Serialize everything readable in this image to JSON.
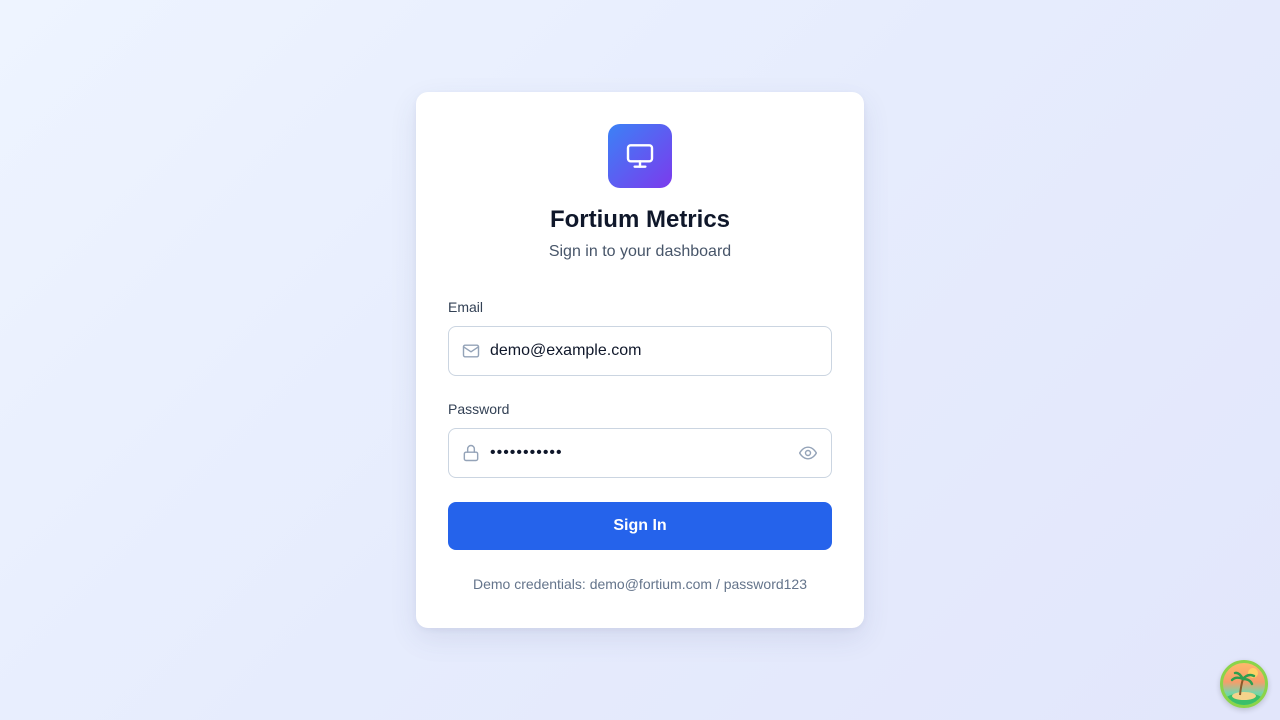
{
  "app": {
    "title": "Fortium Metrics",
    "subtitle": "Sign in to your dashboard"
  },
  "form": {
    "email": {
      "label": "Email",
      "value": "demo@example.com",
      "icon": "mail-icon"
    },
    "password": {
      "label": "Password",
      "masked_value": "•••••••••••",
      "icon": "lock-icon",
      "toggle_icon": "eye-icon"
    },
    "submit_label": "Sign In"
  },
  "footer": {
    "demo_note": "Demo credentials: demo@fortium.com / password123"
  },
  "colors": {
    "primary": "#2563eb",
    "logo_gradient_start": "#3b82f6",
    "logo_gradient_end": "#7c3aed",
    "title": "#0f172a",
    "muted": "#64748b"
  },
  "icons": {
    "logo": "monitor-icon",
    "corner": "island-avatar-icon"
  }
}
